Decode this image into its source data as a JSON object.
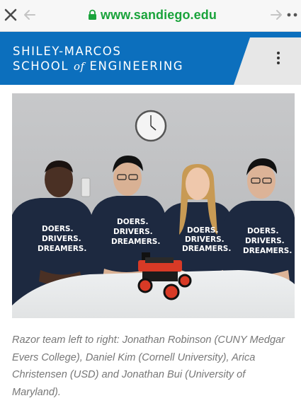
{
  "browser": {
    "url": "www.sandiego.edu",
    "icons": {
      "close": "close-icon",
      "back": "back-arrow-icon",
      "forward": "forward-arrow-icon",
      "lock": "lock-icon",
      "more": "overflow-dots-icon"
    },
    "colors": {
      "url_green": "#1aa33b",
      "chrome_bg": "#f7f7f7"
    }
  },
  "header": {
    "line1": "SHILEY-MARCOS",
    "line2_a": "SCHOOL",
    "line2_of": "of",
    "line2_b": "ENGINEERING",
    "menu_icon": "vertical-dots-menu-icon",
    "colors": {
      "brand_blue": "#0c6fbd",
      "wedge_grey": "#e7e7e7"
    }
  },
  "photo": {
    "shirt_text": [
      "DOERS.",
      "DRIVERS.",
      "DREAMERS."
    ]
  },
  "caption": "Razor team left to right: Jonathan Robinson (CUNY Medgar Evers College), Daniel Kim (Cornell University), Arica Christensen (USD) and Jonathan Bui (University of Maryland)."
}
